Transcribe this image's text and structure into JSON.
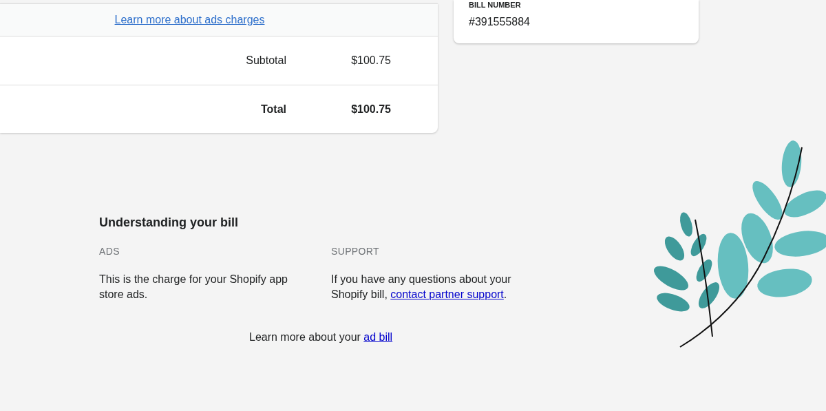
{
  "charges_card": {
    "link": "Learn more about ads charges",
    "rows": [
      {
        "kind": "subtotal",
        "label": "Subtotal",
        "amount": "$100.75"
      },
      {
        "kind": "total",
        "label": "Total",
        "amount": "$100.75"
      }
    ]
  },
  "bill_card": {
    "label": "BILL NUMBER",
    "value": "#391555884"
  },
  "understanding": {
    "title": "Understanding your bill",
    "sections": [
      {
        "heading": "ADS",
        "text": "This is the charge for your Shopify app store ads."
      },
      {
        "heading": "SUPPORT",
        "text": "If you have any questions about your Shopify bill, ",
        "link": "contact partner support",
        "after": "."
      }
    ],
    "footer": {
      "text": "Learn more about your ",
      "link": "ad bill"
    }
  }
}
